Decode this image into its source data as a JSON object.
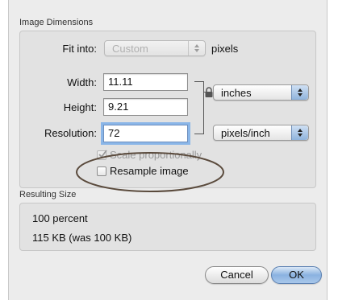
{
  "image_dimensions": {
    "title": "Image Dimensions",
    "fit_into": {
      "label": "Fit into:",
      "value": "Custom",
      "unit": "pixels"
    },
    "width": {
      "label": "Width:",
      "value": "11.11"
    },
    "height": {
      "label": "Height:",
      "value": "9.21"
    },
    "resolution": {
      "label": "Resolution:",
      "value": "72"
    },
    "size_unit": "inches",
    "resolution_unit": "pixels/inch",
    "scale_proportionally": {
      "label": "Scale proportionally",
      "checked": true,
      "enabled": false
    },
    "resample_image": {
      "label": "Resample image",
      "checked": false
    }
  },
  "resulting_size": {
    "title": "Resulting Size",
    "percent": "100 percent",
    "file_size": "115 KB (was 100 KB)"
  },
  "buttons": {
    "cancel": "Cancel",
    "ok": "OK"
  },
  "annotation": {
    "color": "#5a4a3c"
  }
}
